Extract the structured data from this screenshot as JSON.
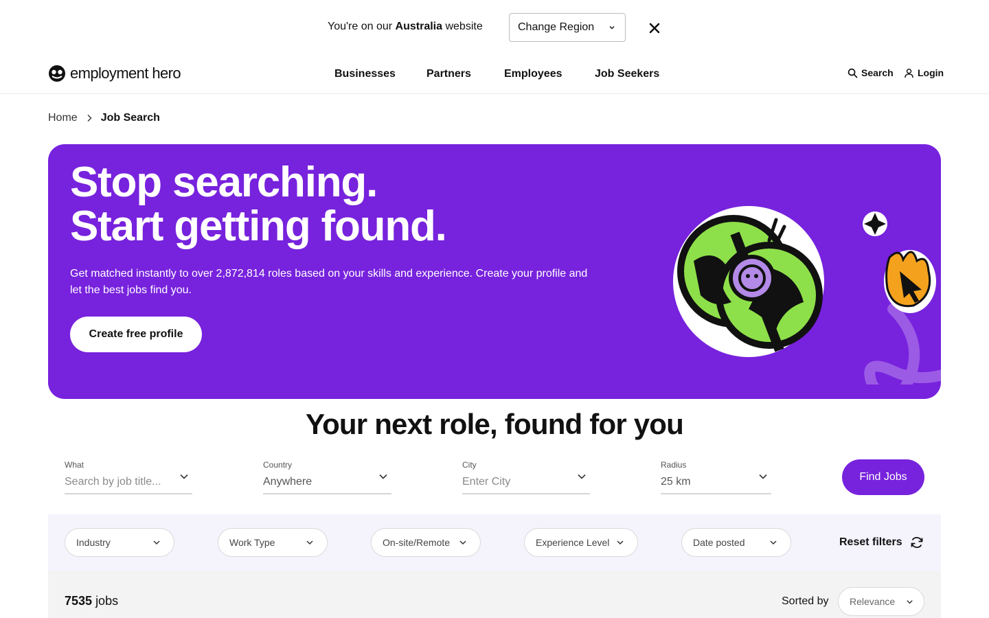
{
  "region_banner": {
    "prefix": "You're on our",
    "country": "Australia",
    "suffix": "website",
    "select_label": "Change Region"
  },
  "header": {
    "brand": "employment hero",
    "nav": [
      "Businesses",
      "Partners",
      "Employees",
      "Job Seekers"
    ],
    "search_label": "Search",
    "login_label": "Login"
  },
  "breadcrumb": {
    "home": "Home",
    "current": "Job Search"
  },
  "hero": {
    "title_line1": "Stop searching.",
    "title_line2": "Start getting found.",
    "description": "Get matched instantly to over 2,872,814 roles based on your skills and experience. Create your profile and let the best jobs find you.",
    "cta": "Create free profile"
  },
  "search": {
    "heading": "Your next role, found for you",
    "fields": [
      {
        "label": "What",
        "value": "Search by job title..."
      },
      {
        "label": "Country",
        "value": "Anywhere"
      },
      {
        "label": "City",
        "value": "Enter City"
      },
      {
        "label": "Radius",
        "value": "25 km"
      }
    ],
    "button": "Find Jobs"
  },
  "filters": {
    "items": [
      "Industry",
      "Work Type",
      "On-site/Remote",
      "Experience Level",
      "Date posted"
    ],
    "reset": "Reset filters"
  },
  "results": {
    "count": "7535",
    "count_suffix": "jobs",
    "sort_label": "Sorted by",
    "sort_value": "Relevance"
  },
  "colors": {
    "brand_purple": "#7722dd",
    "filters_bg": "#f5f3fc",
    "results_bg": "#f3f3f3"
  }
}
